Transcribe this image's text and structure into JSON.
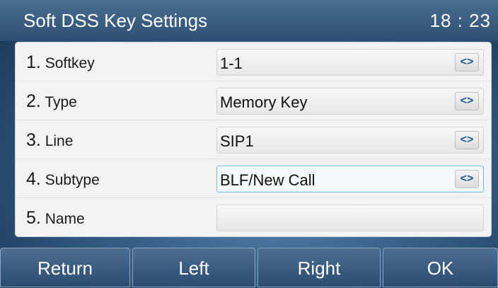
{
  "header": {
    "title": "Soft DSS Key Settings",
    "time": "18 : 23"
  },
  "settings": {
    "rows": [
      {
        "number": "1.",
        "label": "Softkey",
        "value": "1-1",
        "has_switch": true,
        "switch_icon": "<>"
      },
      {
        "number": "2.",
        "label": "Type",
        "value": "Memory Key",
        "has_switch": true,
        "switch_icon": "<>"
      },
      {
        "number": "3.",
        "label": "Line",
        "value": "SIP1",
        "has_switch": true,
        "switch_icon": "<>"
      },
      {
        "number": "4.",
        "label": "Subtype",
        "value": "BLF/New Call",
        "has_switch": true,
        "switch_icon": "<>"
      },
      {
        "number": "5.",
        "label": "Name",
        "value": "",
        "has_switch": false
      }
    ],
    "selected_row": 4
  },
  "softkeys": [
    {
      "label": "Return"
    },
    {
      "label": "Left"
    },
    {
      "label": "Right"
    },
    {
      "label": "OK"
    }
  ],
  "colors": {
    "accent": "#79b6de",
    "titlebar": "#2d4f73",
    "arrow": "#1f5a8a"
  }
}
